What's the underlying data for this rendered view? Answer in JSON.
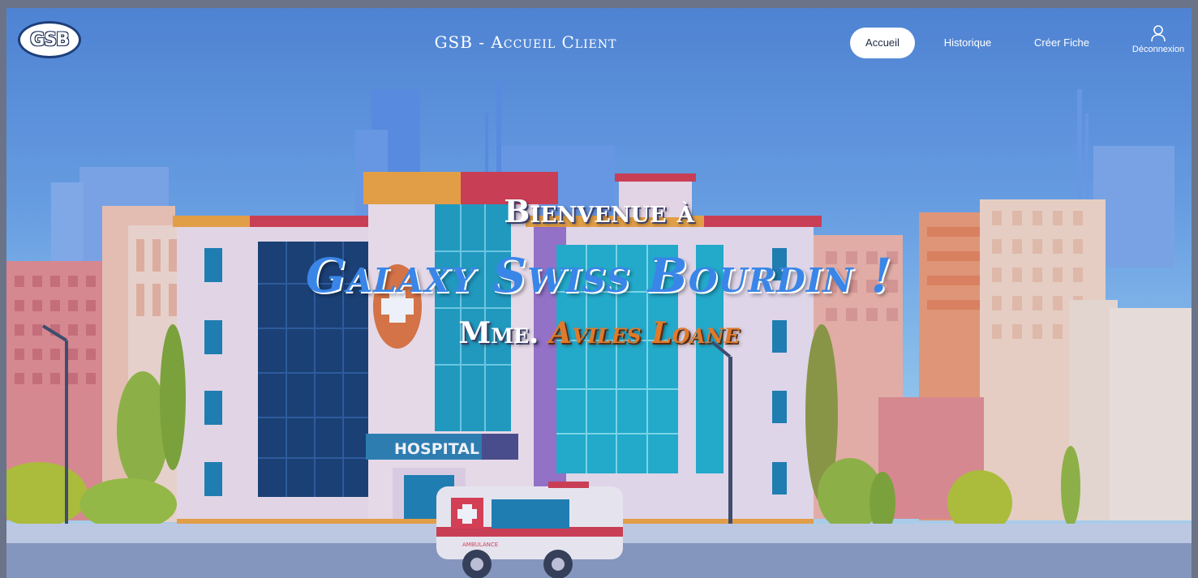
{
  "header": {
    "logo_text": "GSB",
    "title": "GSB - Accueil Client",
    "nav": [
      {
        "label": "Accueil",
        "active": true
      },
      {
        "label": "Historique",
        "active": false
      },
      {
        "label": "Créer Fiche",
        "active": false
      }
    ],
    "logout": {
      "label": "Déconnexion",
      "icon": "user-icon"
    }
  },
  "hero": {
    "line1": "Bienvenue à",
    "line2": "Galaxy Swiss Bourdin !",
    "line3_prefix": "Mme.",
    "line3_name": "Aviles Loane"
  },
  "illustration": {
    "hospital_sign": "HOSPITAL",
    "ambulance_label": "AMBULANCE"
  },
  "colors": {
    "sky_top": "#4f86d6",
    "accent_blue": "#3a86e8",
    "accent_orange": "#e07a2c",
    "roof_red": "#d63a4a",
    "roof_yellow": "#f2a43a"
  }
}
